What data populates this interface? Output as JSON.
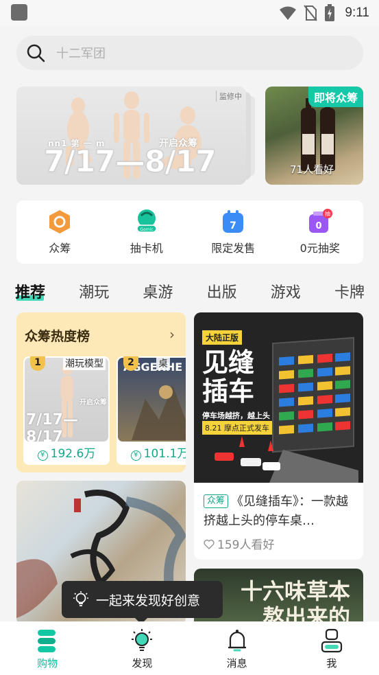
{
  "status_bar": {
    "time": "9:11"
  },
  "search": {
    "placeholder": "十二军团"
  },
  "banner_main": {
    "tag": "监修中",
    "subtitle": "nn1 第 一 m",
    "open_text": "开启众筹",
    "date_range": "7/17—8/17"
  },
  "banner_side": {
    "label": "即将众筹",
    "count": "71人看好"
  },
  "quick_links": [
    {
      "label": "众筹",
      "icon": "crowdfund-icon",
      "color": "#f39a3c"
    },
    {
      "label": "抽卡机",
      "icon": "card-machine-icon",
      "color": "#18c39b"
    },
    {
      "label": "限定发售",
      "icon": "limited-sale-icon",
      "color": "#3b8cf5"
    },
    {
      "label": "0元抽奖",
      "icon": "free-lottery-icon",
      "color": "#9b57f5",
      "badge": "抽"
    }
  ],
  "tabs": [
    "推荐",
    "潮玩",
    "桌游",
    "出版",
    "游戏",
    "卡牌"
  ],
  "hot_list": {
    "title": "众筹热度榜",
    "items": [
      {
        "rank": "1",
        "category": "潮玩模型",
        "price": "192.6万",
        "image_text": "7/17—8/17",
        "image_sub": "开启众筹"
      },
      {
        "rank": "2",
        "category": "桌",
        "price": "101.1万",
        "image_text": "AGGERHE"
      }
    ]
  },
  "feature": {
    "badge": "大陆正版",
    "title_big_1": "见缝",
    "title_big_2": "插车",
    "subtitle": "停车场越挤，越上头",
    "date_text": "8.21 摩点正式发车",
    "tag": "众筹",
    "text": "《见缝插车》：一款越挤越上头的停车桌…",
    "likes": "159人看好"
  },
  "feature2": {
    "line1": "十六味草本",
    "line2": "熬出来的"
  },
  "toast": {
    "text": "一起来发现好创意"
  },
  "bottom_nav": [
    {
      "label": "购物",
      "icon": "shopping-icon",
      "active": true
    },
    {
      "label": "发现",
      "icon": "discover-bulb-icon",
      "active": false
    },
    {
      "label": "消息",
      "icon": "bell-icon",
      "active": false
    },
    {
      "label": "我",
      "icon": "profile-icon",
      "active": false
    }
  ],
  "colors": {
    "accent": "#12b99a",
    "hot_bg": "#fce9b7",
    "side_label": "#14c8a8"
  }
}
